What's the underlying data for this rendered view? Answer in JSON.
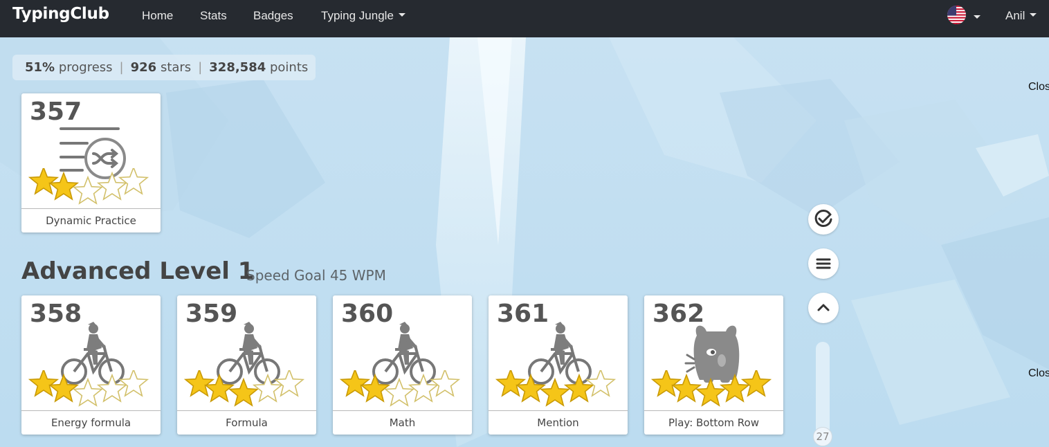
{
  "navbar": {
    "brand": "TypingClub",
    "links": [
      "Home",
      "Stats",
      "Badges"
    ],
    "dropdown": "Typing Jungle",
    "user": "Anil",
    "flag_icon": "us-flag-icon"
  },
  "stats": {
    "progress_value": "51%",
    "progress_label": "progress",
    "stars_value": "926",
    "stars_label": "stars",
    "points_value": "328,584",
    "points_label": "points"
  },
  "top_card": {
    "number": "357",
    "label": "Dynamic Practice",
    "icon": "shuffle-list-icon",
    "stars_earned": 2,
    "stars_total": 5
  },
  "level": {
    "title": "Advanced Level 1",
    "goal": "Speed Goal 45 WPM"
  },
  "lessons": [
    {
      "number": "358",
      "label": "Energy formula",
      "icon": "cyclist-icon",
      "stars_earned": 2,
      "stars_total": 5
    },
    {
      "number": "359",
      "label": "Formula",
      "icon": "cyclist-icon",
      "stars_earned": 3,
      "stars_total": 5
    },
    {
      "number": "360",
      "label": "Math",
      "icon": "cyclist-icon",
      "stars_earned": 2,
      "stars_total": 5
    },
    {
      "number": "361",
      "label": "Mention",
      "icon": "cyclist-icon",
      "stars_earned": 4,
      "stars_total": 5
    },
    {
      "number": "362",
      "label": "Play: Bottom Row",
      "icon": "monster-icon",
      "stars_earned": 5,
      "stars_total": 5
    }
  ],
  "side": {
    "counter": "27",
    "check_icon": "check-circle-icon",
    "menu_icon": "menu-icon",
    "up_icon": "chevron-up-icon"
  },
  "cutoff_text": [
    "Clos",
    "Clos"
  ],
  "colors": {
    "navbar": "#262a30",
    "star_filled": "#f5c518",
    "star_empty": "#ffffff"
  }
}
